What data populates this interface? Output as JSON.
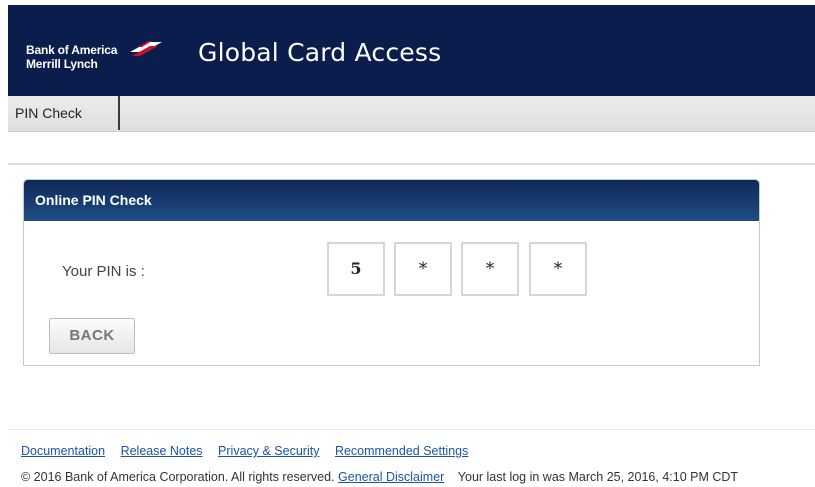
{
  "header": {
    "logo_line1": "Bank of America",
    "logo_line2": "Merrill Lynch",
    "app_title": "Global Card Access"
  },
  "nav": {
    "tabs": [
      {
        "label": "PIN Check"
      }
    ]
  },
  "panel": {
    "title": "Online PIN Check",
    "pin_label": "Your PIN is :",
    "pin_chars": [
      "5",
      "*",
      "*",
      "*"
    ],
    "back_label": "BACK"
  },
  "footer": {
    "links": [
      "Documentation",
      "Release Notes",
      "Privacy & Security",
      "Recommended Settings"
    ],
    "copyright": "© 2016 Bank of America Corporation. All rights reserved.",
    "disclaimer_link": "General Disclaimer",
    "last_login": "Your last log in was March 25, 2016, 4:10 PM CDT"
  },
  "colors": {
    "header_bg": "#0b1d4d",
    "panel_header": "#1f4d86",
    "link": "#1a55a6",
    "logo_flag": "#c8102e"
  },
  "icons": {
    "logo": "bank-of-america-flag-icon"
  }
}
